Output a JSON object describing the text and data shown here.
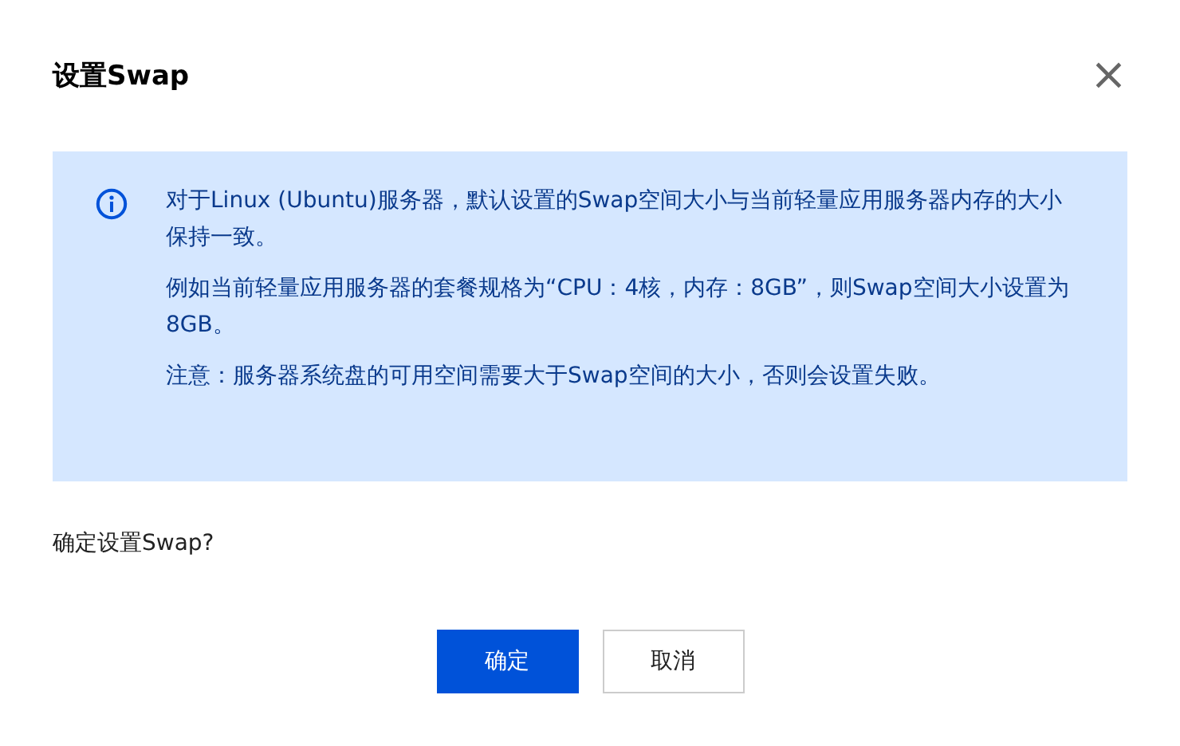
{
  "dialog": {
    "title": "设置Swap",
    "close": "×"
  },
  "notice": {
    "paragraphs": [
      "对于Linux (Ubuntu)服务器，默认设置的Swap空间大小与当前轻量应用服务器内存的大小保持一致。",
      "例如当前轻量应用服务器的套餐规格为“CPU：4核，内存：8GB”，则Swap空间大小设置为8GB。",
      "注意：服务器系统盘的可用空间需要大于Swap空间的大小，否则会设置失败。"
    ]
  },
  "question": "确定设置Swap?",
  "buttons": [
    {
      "label": "确定",
      "kind": "primary"
    },
    {
      "label": "取消",
      "kind": "default"
    }
  ]
}
